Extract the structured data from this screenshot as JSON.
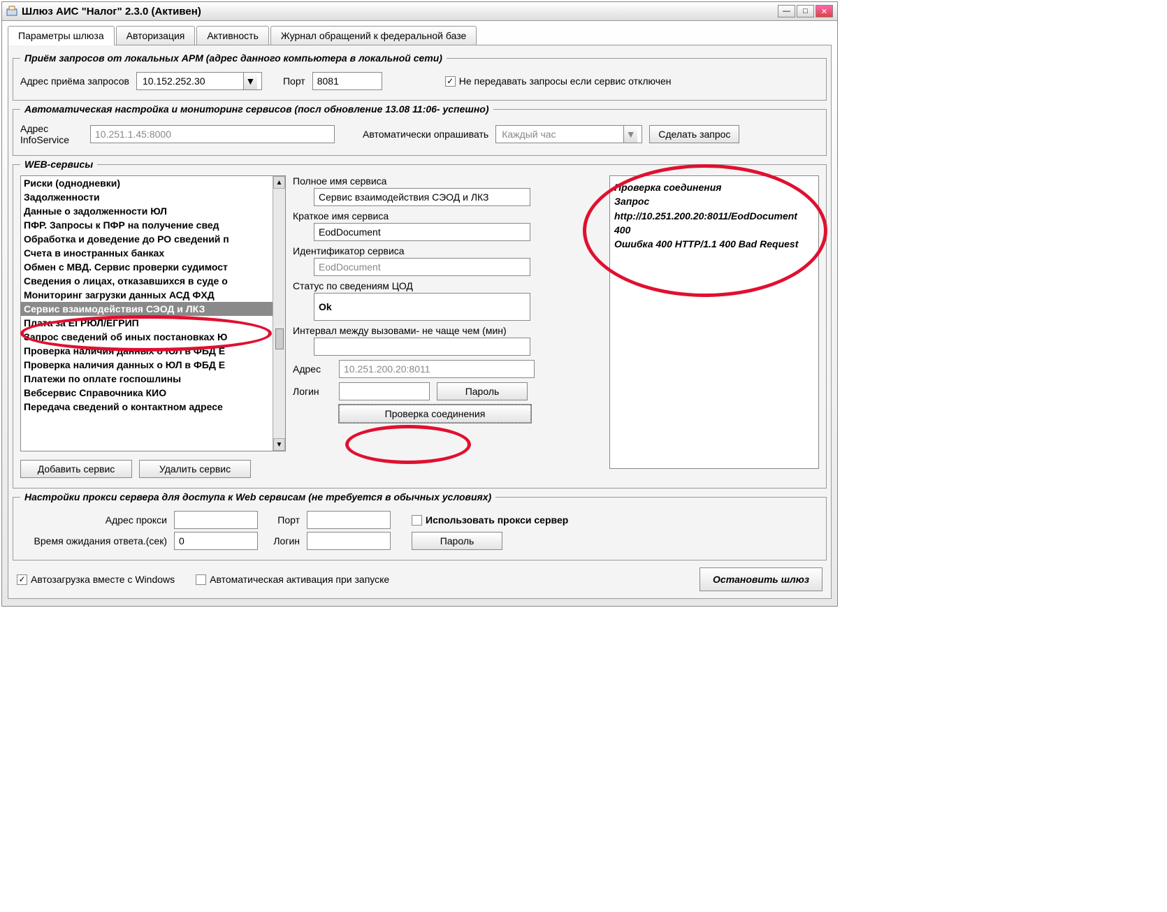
{
  "window": {
    "title": "Шлюз АИС \"Налог\" 2.3.0 (Активен)"
  },
  "tabs": {
    "t0": "Параметры шлюза",
    "t1": "Авторизация",
    "t2": "Активность",
    "t3": "Журнал обращений к федеральной базе"
  },
  "group_request": {
    "legend": "Приём запросов от локальных АРМ (адрес данного компьютера в локальной сети)",
    "addr_label": "Адрес приёма запросов",
    "addr_value": "10.152.252.30",
    "port_label": "Порт",
    "port_value": "8081",
    "chk_label": "Не передавать запросы если сервис отключен"
  },
  "group_auto": {
    "legend": "Автоматическая настройка и мониторинг сервисов (посл обновление  13.08 11:06- успешно)",
    "info_label": "Адрес InfoService",
    "info_value": "10.251.1.45:8000",
    "poll_label": "Автоматически опрашивать",
    "poll_value": "Каждый час",
    "do_request": "Сделать запрос"
  },
  "group_web": {
    "legend": "WEB-сервисы",
    "list": {
      "i0": "Риски (однодневки)",
      "i1": "Задолженности",
      "i2": "Данные о задолженности ЮЛ",
      "i3": "ПФР. Запросы к ПФР на получение свед",
      "i4": "Обработка и доведение до РО сведений п",
      "i5": "Счета в иностранных банках",
      "i6": "Обмен с МВД. Сервис проверки судимост",
      "i7": "Сведения о лицах, отказавшихся в суде о",
      "i8": "Мониторинг загрузки данных АСД ФХД",
      "i9": "Сервис взаимодействия СЭОД и ЛКЗ",
      "i10": "Плата за ЕГРЮЛ/ЕГРИП",
      "i11": "Запрос сведений об иных постановках Ю",
      "i12": "Проверка наличия данных о ЮЛ в ФБД Е",
      "i13": "Проверка наличия данных о ЮЛ в ФБД Е",
      "i14": "Платежи по оплате госпошлины",
      "i15": "Вебсервис Справочника КИО",
      "i16": "Передача сведений о контактном адресе"
    },
    "add_btn": "Добавить сервис",
    "del_btn": "Удалить сервис",
    "full_name_label": "Полное имя сервиса",
    "full_name_value": "Сервис взаимодействия СЭОД и ЛКЗ",
    "short_name_label": "Краткое имя сервиса",
    "short_name_value": "EodDocument",
    "id_label": "Идентификатор сервиса",
    "id_value": "EodDocument",
    "status_label": "Статус по сведениям ЦОД",
    "status_value": "Ok",
    "interval_label": "Интервал между вызовами- не чаще чем (мин)",
    "interval_value": "",
    "addr_label": "Адрес",
    "addr_value": "10.251.200.20:8011",
    "login_label": "Логин",
    "login_value": "",
    "pwd_btn": "Пароль",
    "check_btn": "Проверка соединения",
    "log": {
      "l0": "Проверка соединения",
      "l1": "Запрос",
      "l2": "http://10.251.200.20:8011/EodDocument",
      "l3": "400",
      "l4": "Ошибка 400 HTTP/1.1 400 Bad Request"
    }
  },
  "group_proxy": {
    "legend": "Настройки прокси сервера для доступа к Web сервисам (не требуется в обычных условиях)",
    "addr_label": "Адрес прокси",
    "port_label": "Порт",
    "use_proxy_label": "Использовать прокси сервер",
    "timeout_label": "Время ожидания ответа.(сек)",
    "timeout_value": "0",
    "login_label": "Логин",
    "pwd_btn": "Пароль"
  },
  "bottom": {
    "autoload": "Автозагрузка вместе с Windows",
    "autoactivate": "Автоматическая активация при запуске",
    "stop_btn": "Остановить шлюз"
  }
}
